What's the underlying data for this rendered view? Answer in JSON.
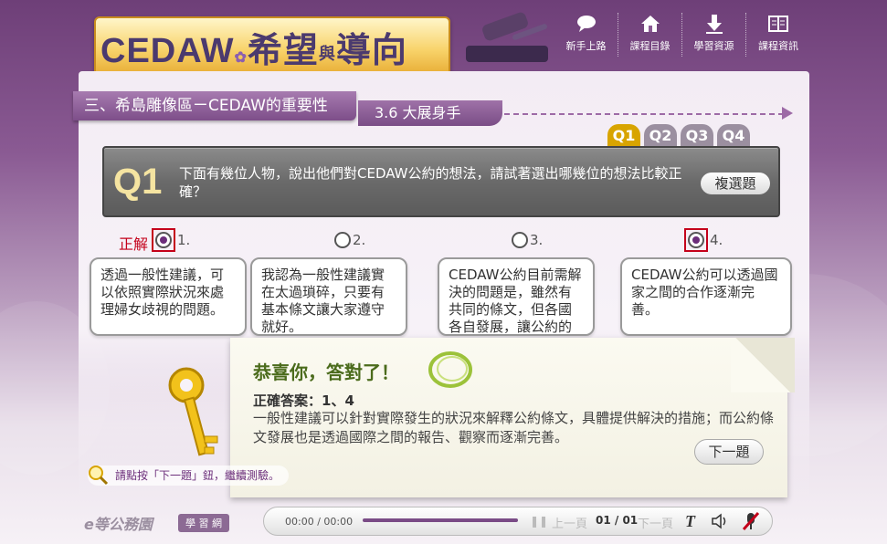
{
  "header": {
    "logo": {
      "main": "CEDAW",
      "part1": "希望",
      "small": "與",
      "part2": "導向"
    },
    "nav": [
      {
        "label": "新手上路",
        "icon": "chat-bubble-icon"
      },
      {
        "label": "課程目錄",
        "icon": "home-icon"
      },
      {
        "label": "學習資源",
        "icon": "download-icon"
      },
      {
        "label": "課程資訊",
        "icon": "book-icon"
      }
    ]
  },
  "section": {
    "title": "三、希島雕像區ㄧCEDAW的重要性",
    "subtitle": "3.6 大展身手"
  },
  "question_tabs": [
    {
      "label": "Q1",
      "active": true
    },
    {
      "label": "Q2",
      "active": false
    },
    {
      "label": "Q3",
      "active": false
    },
    {
      "label": "Q4",
      "active": false
    }
  ],
  "question": {
    "label": "Q1",
    "text": "下面有幾位人物，說出他們對CEDAW公約的想法，請試著選出哪幾位的想法比較正確？",
    "type_button": "複選題"
  },
  "correct_label": "正解",
  "options": [
    {
      "num": "1.",
      "selected": true,
      "text": "透過一般性建議，可以依照實際狀況來處理婦女歧視的問題。"
    },
    {
      "num": "2.",
      "selected": false,
      "text": "我認為一般性建議實在太過瑣碎，只要有基本條文讓大家遵守就好。"
    },
    {
      "num": "3.",
      "selected": false,
      "text": "CEDAW公約目前需解決的問題是，雖然有共同的條文，但各國各自發展，讓公約的全面性受到阻礙。"
    },
    {
      "num": "4.",
      "selected": true,
      "text": "CEDAW公約可以透過國家之間的合作逐漸完善。"
    }
  ],
  "feedback": {
    "title": "恭喜你，答對了！",
    "answer": "正確答案：1、4",
    "explanation": "一般性建議可以針對實際發生的狀況來解釋公約條文，具體提供解決的措施；而公約條文發展也是透過國際之間的報告、觀察而逐漸完善。",
    "next_button": "下一題"
  },
  "hint": "請點按「下一題」鈕，繼續測驗。",
  "footer": {
    "brand": "e等公務園",
    "brand_tag": "學 習 網",
    "time": "00:00 / 00:00",
    "prev": "上一頁",
    "pages": "01 / 01",
    "next": "下一頁",
    "text_btn": "T"
  },
  "colors": {
    "accent": "#7a4b86",
    "correct": "#c4001a",
    "active_tab": "#d8a400",
    "success": "#4b6b1c"
  }
}
